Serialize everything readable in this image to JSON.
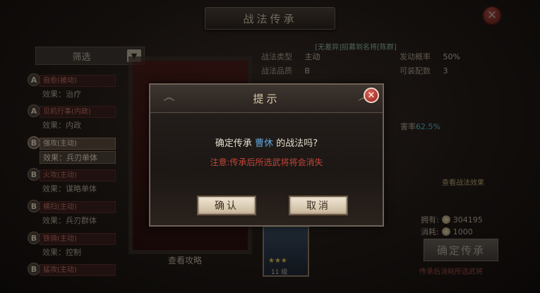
{
  "title": "战法传承",
  "filter": {
    "label": "筛选"
  },
  "skills": [
    {
      "grade": "A",
      "name": "自愈(被动)",
      "effect": "效果：治疗"
    },
    {
      "grade": "A",
      "name": "见机行事(内政)",
      "effect": "效果：内政"
    },
    {
      "grade": "B",
      "name": "强攻(主动)",
      "effect": "效果：兵刃单体"
    },
    {
      "grade": "B",
      "name": "火攻(主动)",
      "effect": "效果：谋略单体"
    },
    {
      "grade": "B",
      "name": "横扫(主动)",
      "effect": "效果：兵刃群体"
    },
    {
      "grade": "B",
      "name": "铁骑(主动)",
      "effect": "效果：控制"
    },
    {
      "grade": "B",
      "name": "猛攻(主动)",
      "effect": ""
    }
  ],
  "info": {
    "top_line": "[无差异]招募到名将[陈群]",
    "type_label": "战法类型",
    "type_value": "主动",
    "rate_label": "发动概率",
    "rate_value": "50%",
    "quality_label": "战法品质",
    "quality_value": "B",
    "config_label": "可装配数",
    "config_value": "3",
    "damage_prefix": "害率",
    "damage_value": "62.5%",
    "upgrade_link": "查看战法效果"
  },
  "guide_link": "查看攻略",
  "general": {
    "level": "11 级"
  },
  "owned": {
    "label1": "拥有:",
    "value1": "304195",
    "label2": "消耗:",
    "value2": "1000"
  },
  "inherit_button": "确定传承",
  "inherit_hint": "传承后消耗所选武将",
  "modal": {
    "title": "提示",
    "confirm_prefix": "确定传承",
    "hero_name": "曹休",
    "confirm_suffix": "的战法吗?",
    "warning": "注意:传承后所选武将将会消失",
    "ok_label": "确认",
    "cancel_label": "取消"
  }
}
